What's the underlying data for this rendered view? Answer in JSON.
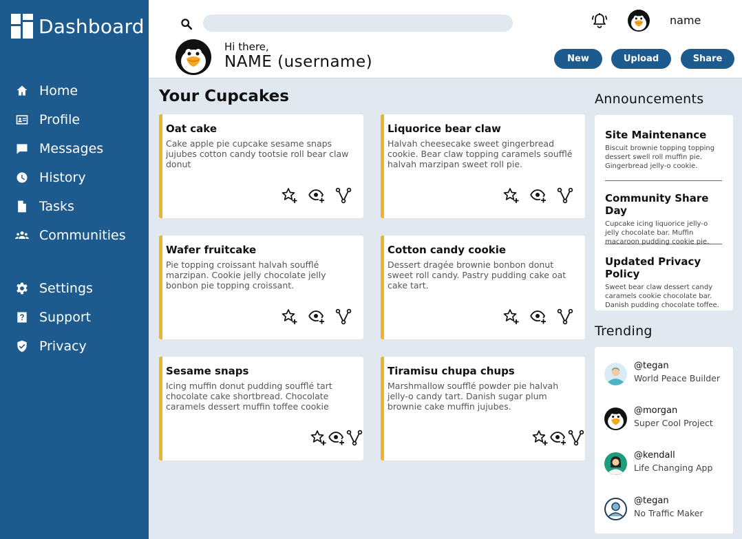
{
  "app": {
    "title": "Dashboard"
  },
  "colors": {
    "sidebar": "#1d5a8d",
    "accent": "#f0b429",
    "background": "#e2e8f0"
  },
  "sidebar": {
    "items": [
      {
        "label": "Home",
        "icon": "home-icon"
      },
      {
        "label": "Profile",
        "icon": "profile-card-icon"
      },
      {
        "label": "Messages",
        "icon": "message-icon"
      },
      {
        "label": "History",
        "icon": "clock-icon"
      },
      {
        "label": "Tasks",
        "icon": "document-icon"
      },
      {
        "label": "Communities",
        "icon": "group-icon"
      },
      {
        "label": "Settings",
        "icon": "gear-icon"
      },
      {
        "label": "Support",
        "icon": "help-icon"
      },
      {
        "label": "Privacy",
        "icon": "shield-icon"
      }
    ]
  },
  "header": {
    "search": {
      "placeholder": "",
      "value": ""
    },
    "user_name": "name",
    "greeting": "Hi there,",
    "username": "NAME (username)",
    "buttons": {
      "new": "New",
      "upload": "Upload",
      "share": "Share"
    }
  },
  "main": {
    "title": "Your Cupcakes",
    "cards": [
      {
        "title": "Oat cake",
        "body": "Cake apple pie cupcake sesame snaps jujubes cotton candy tootsie roll bear claw donut"
      },
      {
        "title": "Liquorice bear claw",
        "body": "Halvah cheesecake sweet gingerbread cookie. Bear claw topping caramels soufflé halvah marzipan sweet roll pie."
      },
      {
        "title": "Wafer fruitcake",
        "body": "Pie topping croissant halvah soufflé marzipan. Cookie jelly chocolate jelly bonbon pie topping croissant."
      },
      {
        "title": "Cotton candy cookie",
        "body": "Dessert dragée brownie bonbon donut sweet roll candy. Pastry pudding cake oat cake tart."
      },
      {
        "title": "Sesame snaps",
        "body": "Icing muffin donut pudding soufflé tart chocolate cake shortbread. Chocolate caramels dessert muffin toffee cookie"
      },
      {
        "title": "Tiramisu chupa chups",
        "body": "Marshmallow soufflé powder pie halvah jelly-o candy tart. Danish sugar plum brownie cake muffin jujubes."
      }
    ]
  },
  "announcements": {
    "title": "Announcements",
    "items": [
      {
        "title": "Site Maintenance",
        "body": "Biscuit brownie topping topping dessert swell roll muffin pie. Gingerbread jelly-o cookie."
      },
      {
        "title": "Community Share Day",
        "body": "Cupcake icing liquorice jelly-o jelly chocolate bar. Muffin macaroon pudding cookie pie."
      },
      {
        "title": "Updated Privacy Policy",
        "body": "Sweet bear claw dessert candy caramels cookie chocolate bar. Danish pudding chocolate toffee."
      }
    ]
  },
  "trending": {
    "title": "Trending",
    "items": [
      {
        "handle": "@tegan",
        "project": "World Peace Builder"
      },
      {
        "handle": "@morgan",
        "project": "Super Cool Project"
      },
      {
        "handle": "@kendall",
        "project": "Life Changing App"
      },
      {
        "handle": "@tegan",
        "project": "No Traffic Maker"
      }
    ]
  }
}
